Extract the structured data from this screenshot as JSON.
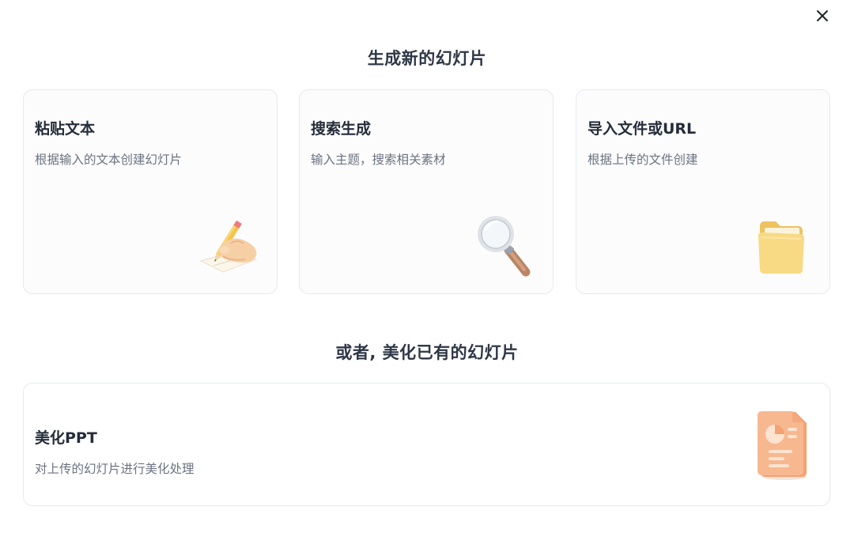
{
  "dialog": {
    "close_icon": "close-icon",
    "section_new_title": "生成新的幻灯片",
    "section_beautify_title": "或者, 美化已有的幻灯片"
  },
  "cards": [
    {
      "title": "粘贴文本",
      "description": "根据输入的文本创建幻灯片",
      "icon": "writing-hand-icon"
    },
    {
      "title": "搜索生成",
      "description": "输入主题，搜索相关素材",
      "icon": "magnifier-icon"
    },
    {
      "title": "导入文件或URL",
      "description": "根据上传的文件创建",
      "icon": "folder-icon"
    }
  ],
  "beautify": {
    "title": "美化PPT",
    "description": "对上传的幻灯片进行美化处理",
    "icon": "presentation-doc-icon"
  },
  "colors": {
    "title_text": "#2e3746",
    "desc_text": "#6b7280",
    "card_border": "#e7e9ee",
    "folder": "#f6d77e",
    "doc_orange": "#f4a77a"
  }
}
